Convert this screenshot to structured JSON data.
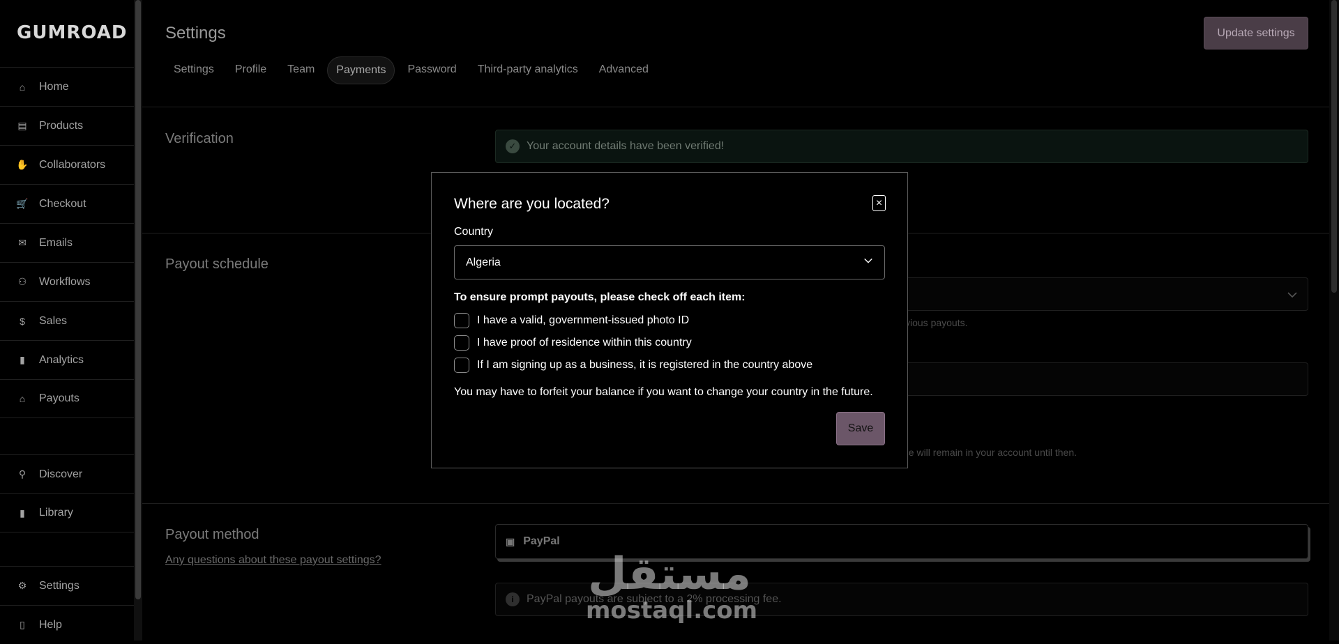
{
  "app": {
    "logo": "GUMROAD"
  },
  "sidebar": {
    "items": [
      {
        "label": "Home",
        "icon": "home-icon",
        "glyph": "⌂"
      },
      {
        "label": "Products",
        "icon": "archive-icon",
        "glyph": "▤"
      },
      {
        "label": "Collaborators",
        "icon": "handshake-icon",
        "glyph": "✋"
      },
      {
        "label": "Checkout",
        "icon": "cart-icon",
        "glyph": "🛒"
      },
      {
        "label": "Emails",
        "icon": "envelope-icon",
        "glyph": "✉"
      },
      {
        "label": "Workflows",
        "icon": "workflow-icon",
        "glyph": "⚇"
      },
      {
        "label": "Sales",
        "icon": "currency-icon",
        "glyph": "$"
      },
      {
        "label": "Analytics",
        "icon": "bar-chart-icon",
        "glyph": "▮"
      },
      {
        "label": "Payouts",
        "icon": "bank-icon",
        "glyph": "⌂"
      },
      {
        "label": "Discover",
        "icon": "search-icon",
        "glyph": "⚲"
      },
      {
        "label": "Library",
        "icon": "bookmark-icon",
        "glyph": "▮"
      },
      {
        "label": "Settings",
        "icon": "gear-icon",
        "glyph": "⚙"
      },
      {
        "label": "Help",
        "icon": "book-icon",
        "glyph": "▯"
      }
    ]
  },
  "header": {
    "title": "Settings",
    "update_button": "Update settings",
    "tabs": [
      {
        "label": "Settings"
      },
      {
        "label": "Profile"
      },
      {
        "label": "Team"
      },
      {
        "label": "Payments",
        "active": true
      },
      {
        "label": "Password"
      },
      {
        "label": "Third-party analytics"
      },
      {
        "label": "Advanced"
      }
    ]
  },
  "sections": {
    "verification": {
      "title": "Verification",
      "status": "Your account details have been verified!"
    },
    "payout_schedule": {
      "title": "Payout schedule",
      "hint1": "vious payouts.",
      "hint2": "nce will remain in your account until then."
    },
    "payout_method": {
      "title": "Payout method",
      "link": "Any questions about these payout settings?",
      "paypal_label": "PayPal",
      "fee_note": "PayPal payouts are subject to a 2% processing fee."
    }
  },
  "modal": {
    "title": "Where are you located?",
    "country_label": "Country",
    "country_value": "Algeria",
    "checklist_title": "To ensure prompt payouts, please check off each item:",
    "checks": [
      {
        "label": "I have a valid, government-issued photo ID",
        "checked": false
      },
      {
        "label": "I have proof of residence within this country",
        "checked": false
      },
      {
        "label": "If I am signing up as a business, it is registered in the country above",
        "checked": false
      }
    ],
    "forfeit_note": "You may have to forfeit your balance if you want to change your country in the future.",
    "save_button": "Save",
    "close_icon": "close-icon"
  },
  "watermark": {
    "arabic": "مستقل",
    "latin": "mostaql.com"
  },
  "colors": {
    "accent": "#6b5668",
    "verified_bg": "#0a1410"
  }
}
